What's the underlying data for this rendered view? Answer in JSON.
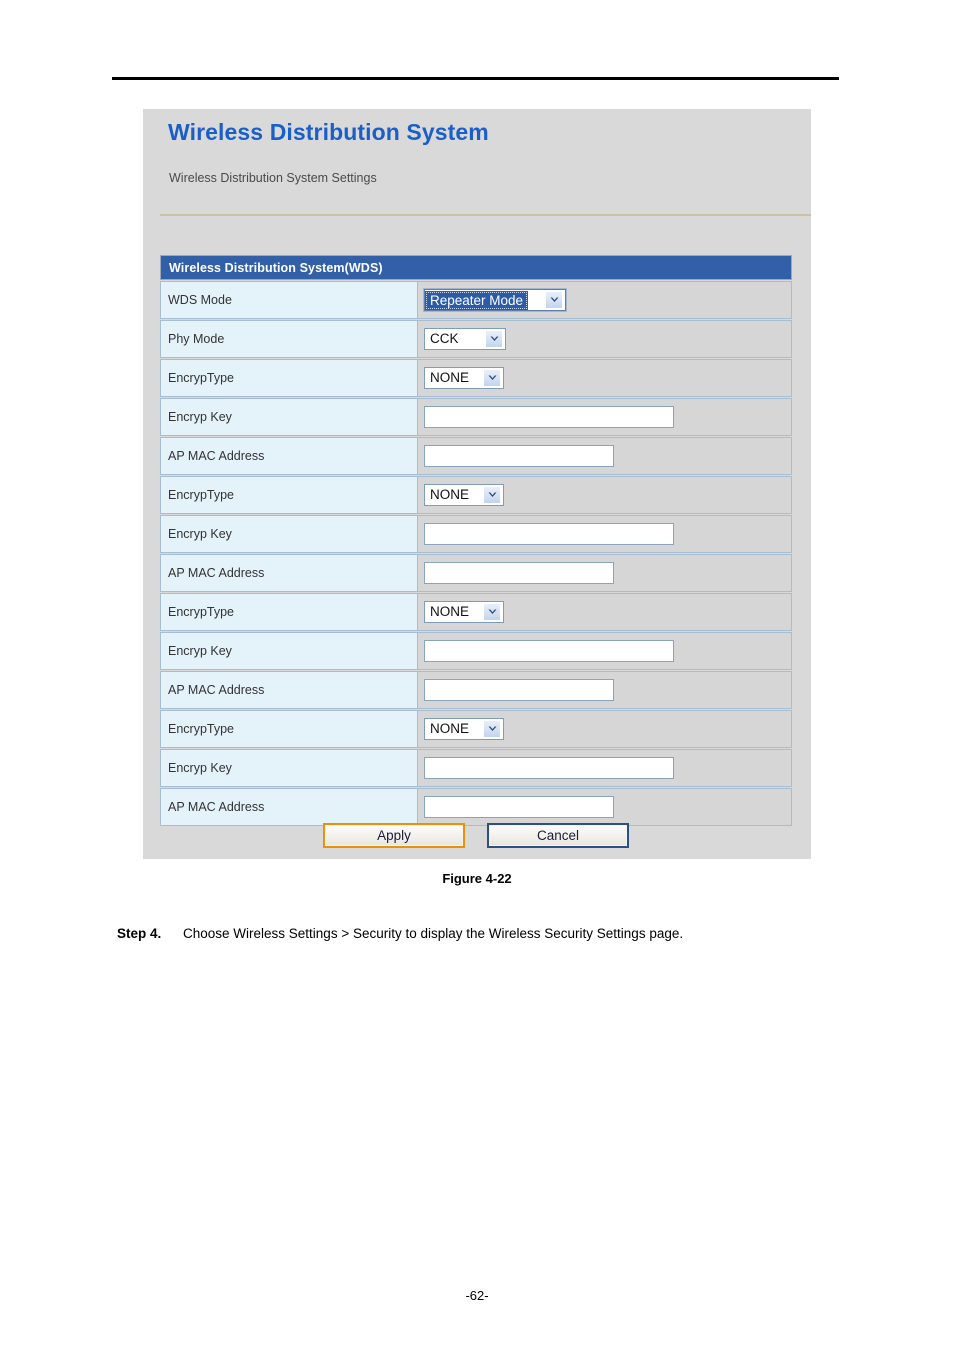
{
  "document": {
    "figure_caption": "Figure 4-22",
    "step_label": "Step 4.",
    "step_text": "Choose Wireless Settings > Security to display the Wireless Security Settings page.",
    "page_number": "-62-"
  },
  "panel": {
    "title": "Wireless Distribution System",
    "subtitle": "Wireless Distribution System Settings",
    "table_header": "Wireless Distribution System(WDS)",
    "accent_blue": "#3160a8",
    "title_blue": "#1a5fc8",
    "label_bg": "#e4f2fa",
    "value_bg": "#d6d6d6",
    "apply_border": "#e8920c",
    "cancel_border": "#2b4f86"
  },
  "rows": [
    {
      "label": "WDS Mode",
      "control": "select",
      "value": "Repeater Mode",
      "width": "select-wds",
      "focused": true
    },
    {
      "label": "Phy Mode",
      "control": "select",
      "value": "CCK",
      "width": "select-cck",
      "focused": false
    },
    {
      "label": "EncrypType",
      "control": "select",
      "value": "NONE",
      "width": "select-none",
      "focused": false
    },
    {
      "label": "Encryp Key",
      "control": "text",
      "value": "",
      "width": "input-key",
      "focused": false
    },
    {
      "label": "AP MAC Address",
      "control": "text",
      "value": "",
      "width": "input-mac",
      "focused": false
    },
    {
      "label": "EncrypType",
      "control": "select",
      "value": "NONE",
      "width": "select-none",
      "focused": false
    },
    {
      "label": "Encryp Key",
      "control": "text",
      "value": "",
      "width": "input-key",
      "focused": false
    },
    {
      "label": "AP MAC Address",
      "control": "text",
      "value": "",
      "width": "input-mac",
      "focused": false
    },
    {
      "label": "EncrypType",
      "control": "select",
      "value": "NONE",
      "width": "select-none",
      "focused": false
    },
    {
      "label": "Encryp Key",
      "control": "text",
      "value": "",
      "width": "input-key",
      "focused": false
    },
    {
      "label": "AP MAC Address",
      "control": "text",
      "value": "",
      "width": "input-mac",
      "focused": false
    },
    {
      "label": "EncrypType",
      "control": "select",
      "value": "NONE",
      "width": "select-none",
      "focused": false
    },
    {
      "label": "Encryp Key",
      "control": "text",
      "value": "",
      "width": "input-key",
      "focused": false
    },
    {
      "label": "AP MAC Address",
      "control": "text",
      "value": "",
      "width": "input-mac",
      "focused": false
    }
  ],
  "buttons": {
    "apply_label": "Apply",
    "cancel_label": "Cancel"
  },
  "icons": {
    "dropdown_arrow": "chevron-down-icon"
  }
}
